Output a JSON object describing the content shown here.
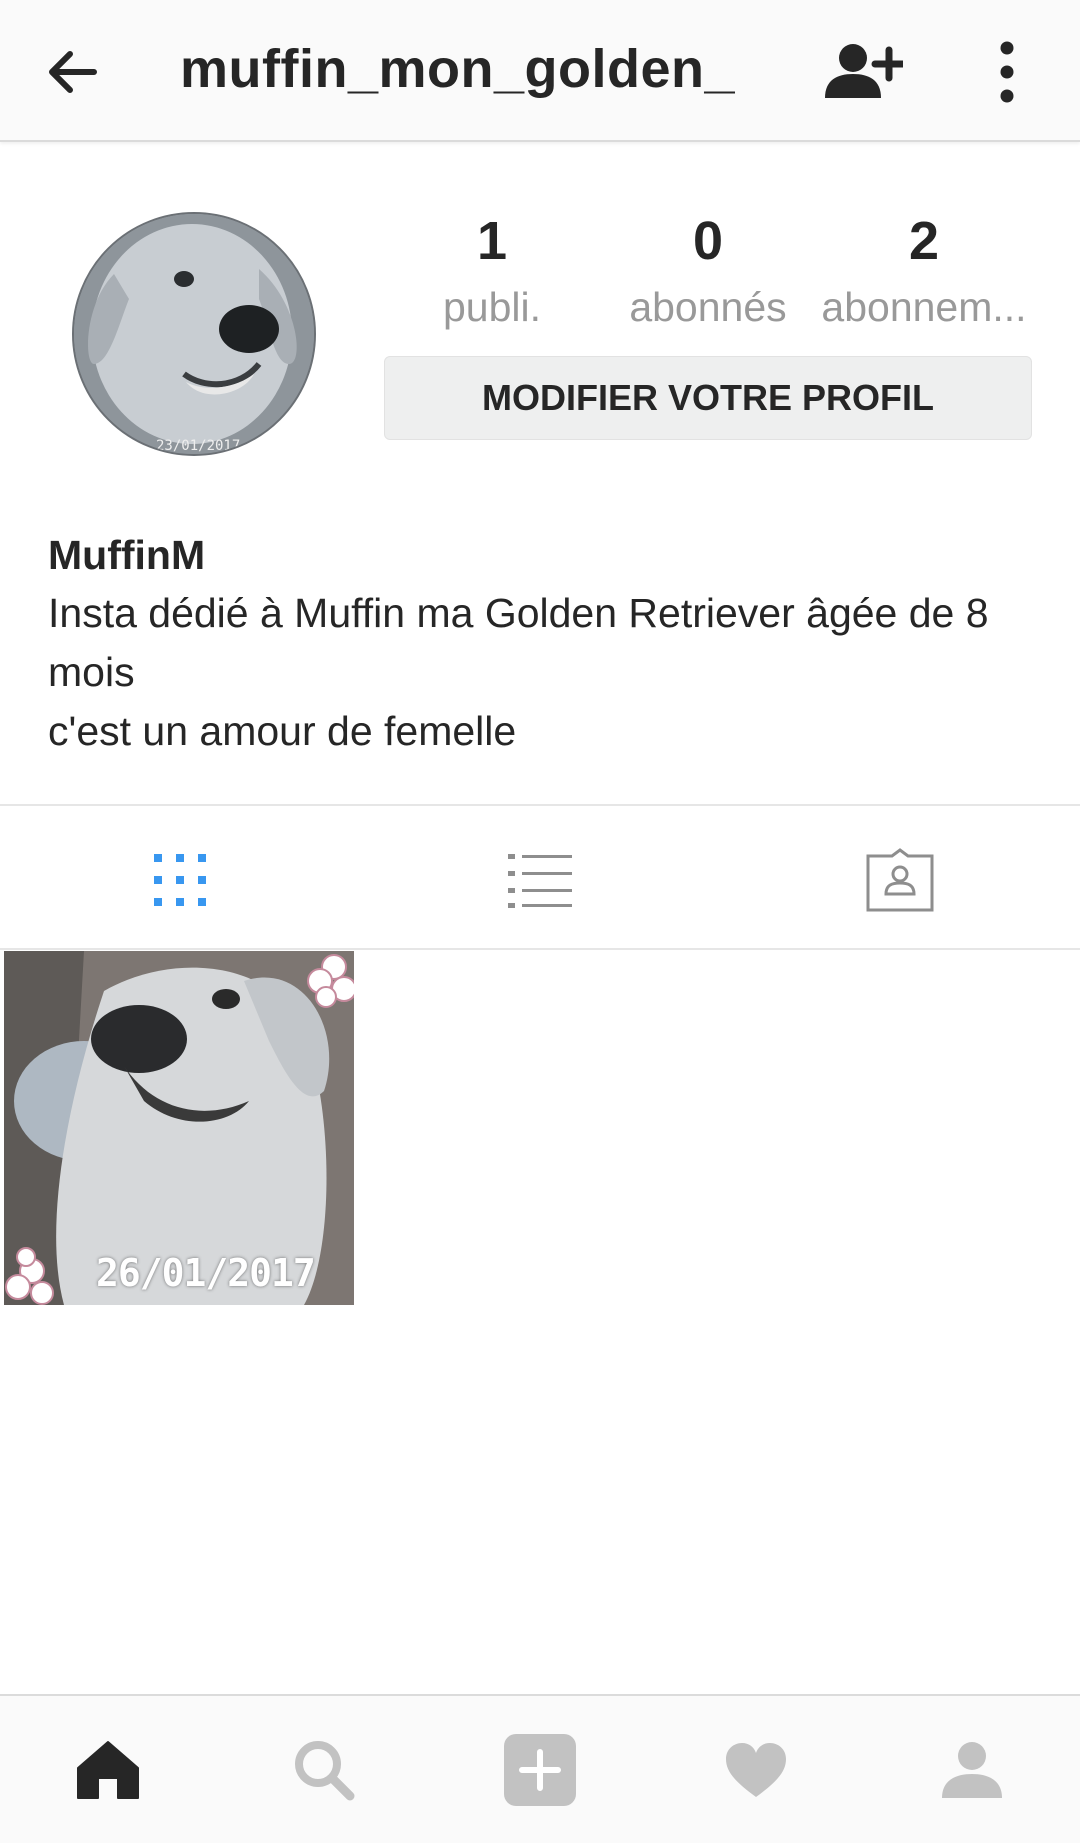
{
  "header": {
    "username": "muffin_mon_golden_",
    "icons": {
      "back": "arrow-left-icon",
      "add_user": "person-add-icon",
      "more": "more-vertical-icon"
    }
  },
  "profile": {
    "avatar_stamp": "23/01/2017",
    "stats": [
      {
        "count": "1",
        "label": "publi."
      },
      {
        "count": "0",
        "label": "abonnés"
      },
      {
        "count": "2",
        "label": "abonnem..."
      }
    ],
    "edit_button_label": "MODIFIER VOTRE PROFIL",
    "display_name": "MuffinM",
    "bio_lines": [
      "Insta dédié à Muffin ma Golden Retriever âgée de 8",
      "mois",
      "c'est un amour de femelle"
    ]
  },
  "view_tabs": [
    {
      "name": "grid",
      "icon": "grid-icon",
      "active": true
    },
    {
      "name": "list",
      "icon": "list-icon",
      "active": false
    },
    {
      "name": "tagged",
      "icon": "tagged-photos-icon",
      "active": false
    }
  ],
  "posts": [
    {
      "date_text": "26/01/2017"
    }
  ],
  "bottom_nav": [
    {
      "icon": "home-icon",
      "active": true
    },
    {
      "icon": "search-icon",
      "active": false
    },
    {
      "icon": "add-post-icon",
      "active": false
    },
    {
      "icon": "heart-icon",
      "active": false
    },
    {
      "icon": "profile-icon",
      "active": false
    }
  ],
  "colors": {
    "accent": "#3897f0",
    "text": "#262626",
    "muted": "#999999",
    "inactive_icon": "#c2c2c2"
  }
}
